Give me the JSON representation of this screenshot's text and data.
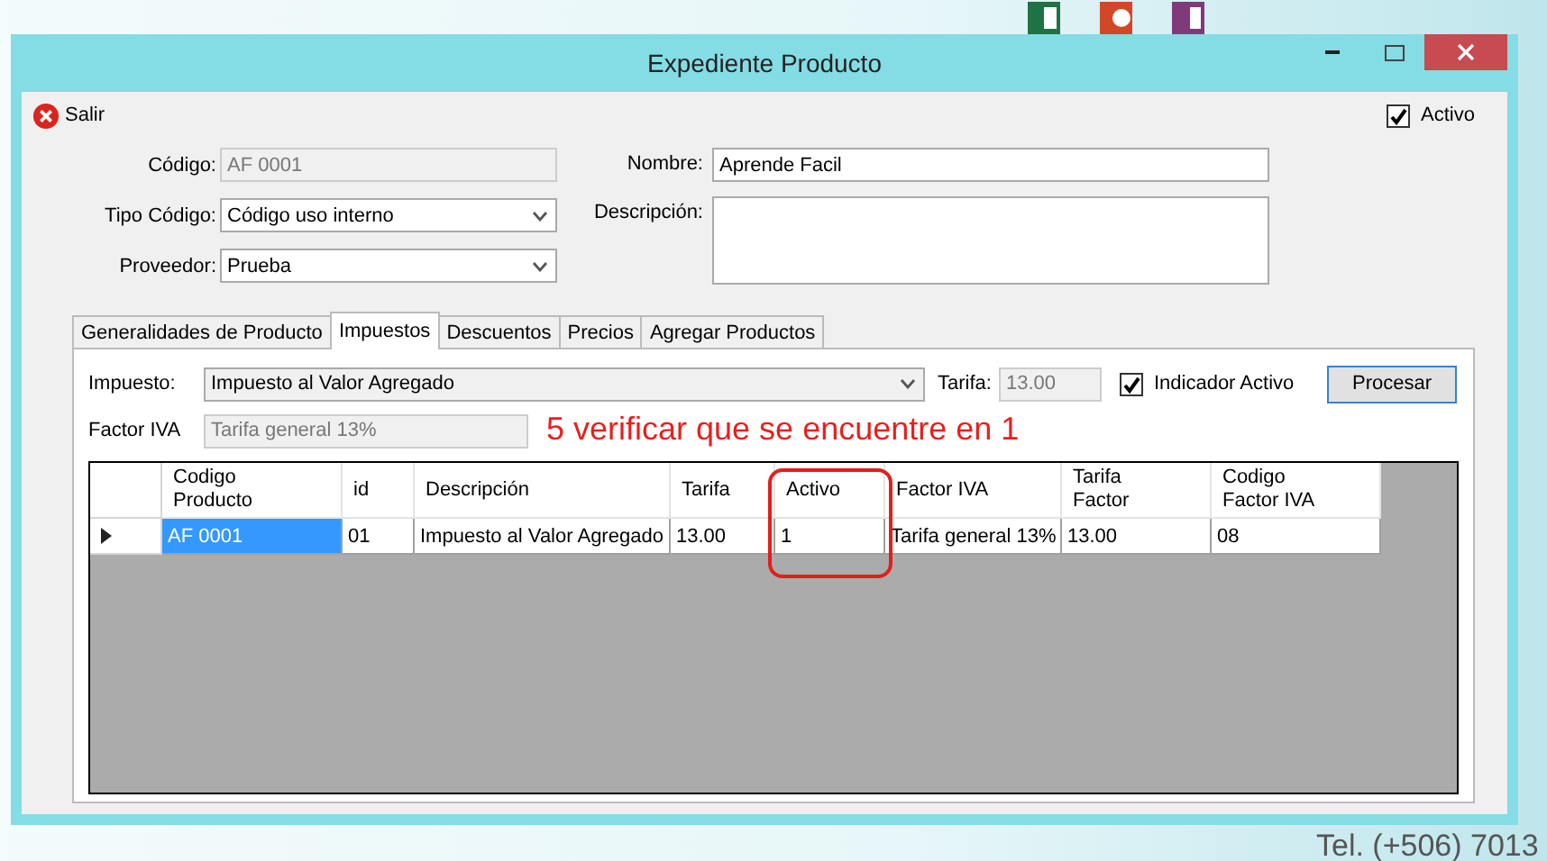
{
  "desktop": {
    "texts": [
      "Tel. (+506) 7013"
    ]
  },
  "window": {
    "title": "Expediente Producto"
  },
  "toolbar": {
    "exit_label": "Salir",
    "active": {
      "label": "Activo",
      "checked": true
    }
  },
  "form": {
    "left": [
      {
        "kind": "text",
        "label": "Código:",
        "value": "AF 0001",
        "disabled": true
      },
      {
        "kind": "combo",
        "label": "Tipo Código:",
        "value": "Código uso interno",
        "disabled": false
      },
      {
        "kind": "combo",
        "label": "Proveedor:",
        "value": "Prueba",
        "disabled": false
      }
    ],
    "right": [
      {
        "kind": "text",
        "label": "Nombre:",
        "value": "Aprende Facil",
        "disabled": false
      },
      {
        "kind": "textarea",
        "label": "Descripción:",
        "disabled": false
      }
    ]
  },
  "tabs": [
    {
      "label": "Generalidades de Producto",
      "selected": false
    },
    {
      "label": "Impuestos",
      "selected": true
    },
    {
      "label": "Descuentos",
      "selected": false
    },
    {
      "label": "Precios",
      "selected": false
    },
    {
      "label": "Agregar Productos",
      "selected": false
    }
  ],
  "tax_panel": {
    "impuesto": {
      "label": "Impuesto:",
      "value": "Impuesto al Valor Agregado"
    },
    "tarifa": {
      "label": "Tarifa:",
      "value": "13.00"
    },
    "indicador": {
      "label": "Indicador Activo",
      "checked": true
    },
    "process_button": "Procesar",
    "factor": {
      "label": "Factor IVA",
      "value": "Tarifa general 13%"
    }
  },
  "grid": {
    "columns": [
      "Codigo\nProducto",
      "id",
      "Descripción",
      "Tarifa",
      "Activo",
      "Factor IVA",
      "Tarifa\nFactor",
      "Codigo\nFactor IVA"
    ],
    "rows": [
      {
        "current": true,
        "cells": [
          {
            "text": "AF 0001",
            "selected": true
          },
          {
            "text": "01",
            "selected": false
          },
          {
            "text": "Impuesto al Valor Agregado",
            "selected": false
          },
          {
            "text": "13.00",
            "selected": false
          },
          {
            "text": "1",
            "selected": false
          },
          {
            "text": "Tarifa general 13%",
            "selected": false
          },
          {
            "text": "13.00",
            "selected": false
          },
          {
            "text": "08",
            "selected": false
          }
        ]
      }
    ]
  },
  "annotation": {
    "text": "5 verificar que se encuentre en 1"
  }
}
